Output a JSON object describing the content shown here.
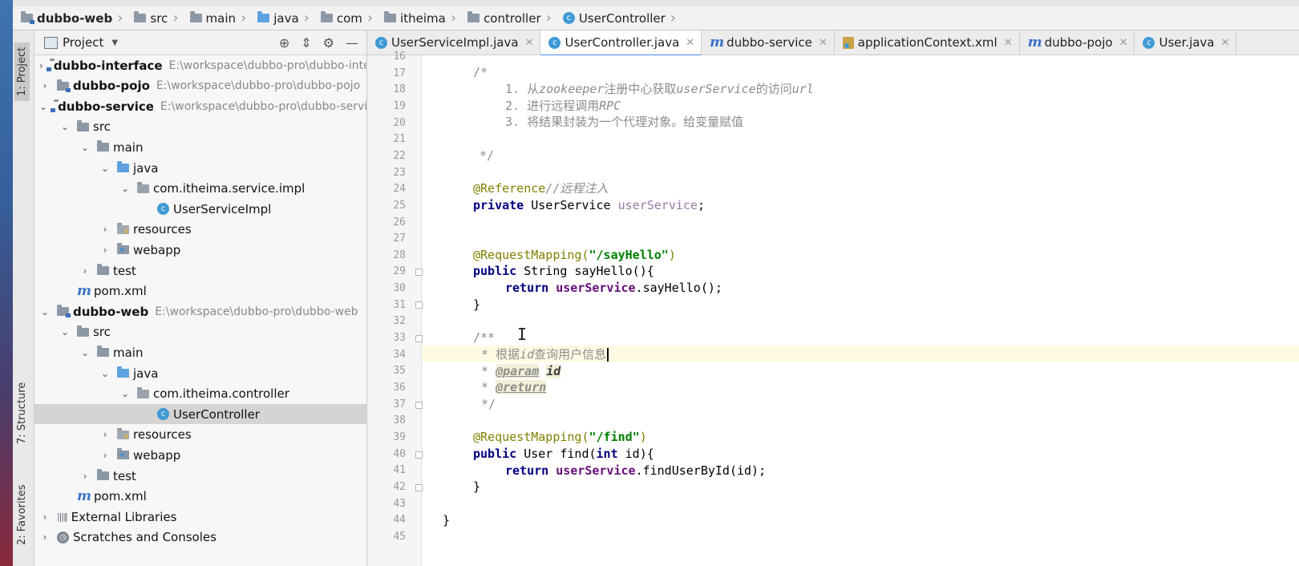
{
  "breadcrumb": [
    {
      "label": "dubbo-web",
      "icon": "module-folder-icon"
    },
    {
      "label": "src",
      "icon": "folder-icon"
    },
    {
      "label": "main",
      "icon": "folder-icon"
    },
    {
      "label": "java",
      "icon": "source-folder-icon"
    },
    {
      "label": "com",
      "icon": "package-icon"
    },
    {
      "label": "itheima",
      "icon": "package-icon"
    },
    {
      "label": "controller",
      "icon": "package-icon"
    },
    {
      "label": "UserController",
      "icon": "class-icon"
    }
  ],
  "sidebar_tabs": {
    "project": "1: Project",
    "structure": "7: Structure",
    "favorites": "2: Favorites"
  },
  "project_panel": {
    "title": "Project"
  },
  "tree": [
    {
      "label": "dubbo-interface",
      "path": "E:\\workspace\\dubbo-pro\\dubbo-interface",
      "arrow": "›",
      "bold": true,
      "icon": "module"
    },
    {
      "label": "dubbo-pojo",
      "path": "E:\\workspace\\dubbo-pro\\dubbo-pojo",
      "arrow": "›",
      "bold": true,
      "icon": "module"
    },
    {
      "label": "dubbo-service",
      "path": "E:\\workspace\\dubbo-pro\\dubbo-service",
      "arrow": "⌄",
      "bold": true,
      "icon": "module"
    },
    {
      "label": "src",
      "path": "",
      "arrow": "⌄",
      "bold": false,
      "icon": "folder"
    },
    {
      "label": "main",
      "path": "",
      "arrow": "⌄",
      "bold": false,
      "icon": "folder"
    },
    {
      "label": "java",
      "path": "",
      "arrow": "⌄",
      "bold": false,
      "icon": "source"
    },
    {
      "label": "com.itheima.service.impl",
      "path": "",
      "arrow": "⌄",
      "bold": false,
      "icon": "package"
    },
    {
      "label": "UserServiceImpl",
      "path": "",
      "arrow": "",
      "bold": false,
      "icon": "class"
    },
    {
      "label": "resources",
      "path": "",
      "arrow": "›",
      "bold": false,
      "icon": "resources"
    },
    {
      "label": "webapp",
      "path": "",
      "arrow": "›",
      "bold": false,
      "icon": "webapp"
    },
    {
      "label": "test",
      "path": "",
      "arrow": "›",
      "bold": false,
      "icon": "folder"
    },
    {
      "label": "pom.xml",
      "path": "",
      "arrow": "",
      "bold": false,
      "icon": "maven"
    },
    {
      "label": "dubbo-web",
      "path": "E:\\workspace\\dubbo-pro\\dubbo-web",
      "arrow": "⌄",
      "bold": true,
      "icon": "module"
    },
    {
      "label": "src",
      "path": "",
      "arrow": "⌄",
      "bold": false,
      "icon": "folder"
    },
    {
      "label": "main",
      "path": "",
      "arrow": "⌄",
      "bold": false,
      "icon": "folder"
    },
    {
      "label": "java",
      "path": "",
      "arrow": "⌄",
      "bold": false,
      "icon": "source"
    },
    {
      "label": "com.itheima.controller",
      "path": "",
      "arrow": "⌄",
      "bold": false,
      "icon": "package"
    },
    {
      "label": "UserController",
      "path": "",
      "arrow": "",
      "bold": false,
      "icon": "class",
      "selected": true
    },
    {
      "label": "resources",
      "path": "",
      "arrow": "›",
      "bold": false,
      "icon": "resources"
    },
    {
      "label": "webapp",
      "path": "",
      "arrow": "›",
      "bold": false,
      "icon": "webapp"
    },
    {
      "label": "test",
      "path": "",
      "arrow": "›",
      "bold": false,
      "icon": "folder"
    },
    {
      "label": "pom.xml",
      "path": "",
      "arrow": "",
      "bold": false,
      "icon": "maven"
    },
    {
      "label": "External Libraries",
      "path": "",
      "arrow": "›",
      "bold": false,
      "icon": "libraries"
    },
    {
      "label": "Scratches and Consoles",
      "path": "",
      "arrow": "›",
      "bold": false,
      "icon": "scratches"
    }
  ],
  "tabs": [
    {
      "label": "UserServiceImpl.java",
      "icon": "class",
      "active": false
    },
    {
      "label": "UserController.java",
      "icon": "class",
      "active": true
    },
    {
      "label": "dubbo-service",
      "icon": "maven",
      "active": false
    },
    {
      "label": "applicationContext.xml",
      "icon": "xml",
      "active": false
    },
    {
      "label": "dubbo-pojo",
      "icon": "maven",
      "active": false
    },
    {
      "label": "User.java",
      "icon": "class",
      "active": false
    }
  ],
  "line_numbers": [
    "16",
    "17",
    "18",
    "19",
    "20",
    "21",
    "22",
    "23",
    "24",
    "25",
    "26",
    "27",
    "28",
    "29",
    "30",
    "31",
    "32",
    "33",
    "34",
    "35",
    "36",
    "37",
    "38",
    "39",
    "40",
    "41",
    "42",
    "43",
    "44",
    "45"
  ],
  "code": {
    "l17": "/*",
    "l18a": "1. 从",
    "l18b": "zookeeper",
    "l18c": "注册中心获取",
    "l18d": "userService",
    "l18e": "的访问",
    "l18f": "url",
    "l19a": "2. 进行远程调用",
    "l19b": "RPC",
    "l20": "3. 将结果封装为一个代理对象。给变量赋值",
    "l22": "*/",
    "l24a": "@Reference",
    "l24b": "//远程注入",
    "l25a": "private",
    "l25b": " UserService ",
    "l25c": "userService",
    "l25d": ";",
    "l28a": "@RequestMapping(",
    "l28b": "\"/sayHello\"",
    "l28c": ")",
    "l29a": "public",
    "l29b": " String sayHello(){",
    "l30a": "return",
    "l30b": " ",
    "l30c": "userService",
    "l30d": ".sayHello();",
    "l31": "}",
    "l33": "/**",
    "l34a": "* 根据",
    "l34b": "id",
    "l34c": "查询用户信息",
    "l35a": "* ",
    "l35b": "@param",
    "l35c": "id",
    "l36a": "* ",
    "l36b": "@return",
    "l37": "*/",
    "l39a": "@RequestMapping(",
    "l39b": "\"/find\"",
    "l39c": ")",
    "l40a": "public",
    "l40b": " User find(",
    "l40c": "int",
    "l40d": " id){",
    "l41a": "return",
    "l41b": " ",
    "l41c": "userService",
    "l41d": ".findUserById(id);",
    "l42": "}",
    "l44": "}"
  },
  "colors": {
    "annotation": "#808000",
    "keyword": "#000080",
    "string": "#008000",
    "field": "#660e7a",
    "comment": "#8c8c8c",
    "current_line": "#fffae3",
    "tab_accent": "#4a86e8"
  }
}
